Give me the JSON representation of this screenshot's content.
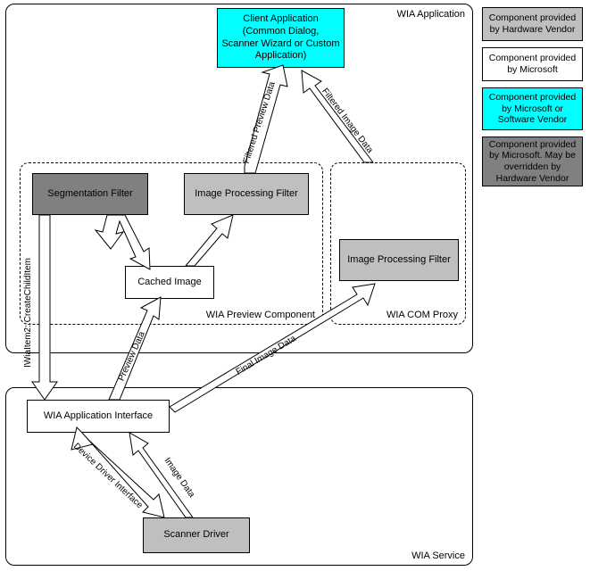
{
  "containers": {
    "wia_application": "WIA Application",
    "wia_preview_component": "WIA Preview Component",
    "wia_com_proxy": "WIA COM Proxy",
    "wia_service": "WIA Service"
  },
  "boxes": {
    "client_app": "Client Application\n(Common Dialog,\nScanner Wizard or Custom\nApplication)",
    "segmentation_filter": "Segmentation Filter",
    "image_processing_filter": "Image Processing Filter",
    "image_processing_filter2": "Image Processing Filter",
    "cached_image": "Cached Image",
    "wia_app_interface": "WIA Application Interface",
    "scanner_driver": "Scanner Driver"
  },
  "arrow_labels": {
    "filtered_preview_data": "Filtered Preview Data",
    "filtered_image_data": "Filtered Image Data",
    "create_child_item": "IWiaItem2::CreateChildItem",
    "preview_data": "Preview Data",
    "final_image_data": "Final Image Data",
    "device_driver_interface": "Device Driver Interface",
    "image_data": "Image Data"
  },
  "legend": {
    "hw_vendor": "Component provided by Hardware Vendor",
    "microsoft": "Component provided by Microsoft",
    "ms_or_sw_vendor": "Component provided by Microsoft or Software Vendor",
    "ms_override_hw": "Component provided by Microsoft. May be overridden by Hardware Vendor"
  },
  "colors": {
    "cyan": "#00ffff",
    "gray_light": "#bfbfbf",
    "gray_mid": "#a0a0a0",
    "gray_dark": "#808080",
    "white": "#ffffff"
  }
}
